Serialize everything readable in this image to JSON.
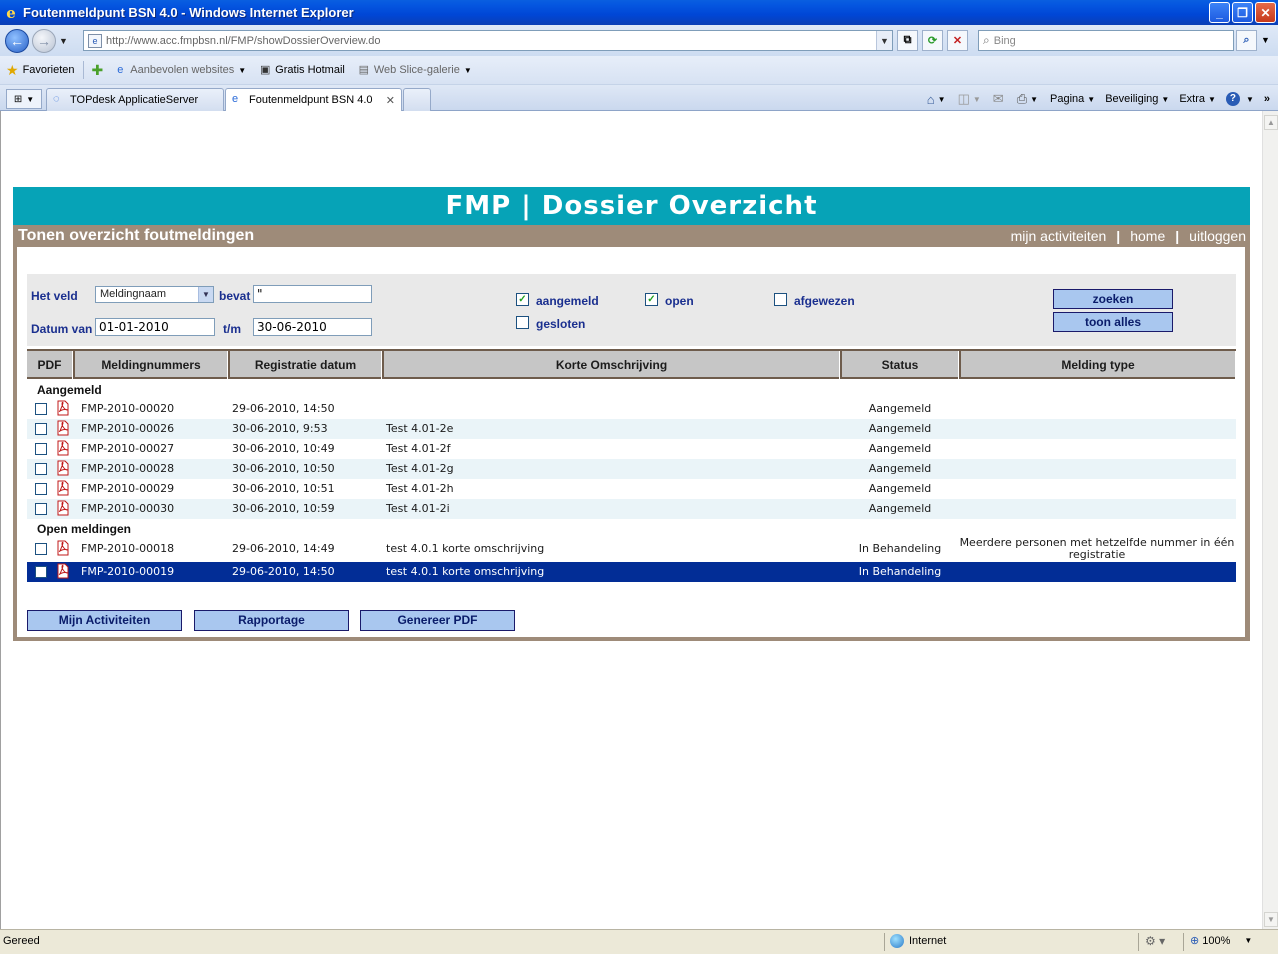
{
  "window": {
    "title": "Foutenmeldpunt BSN 4.0 - Windows Internet Explorer",
    "controls": [
      "minimize",
      "maximize",
      "close"
    ]
  },
  "address_bar": {
    "url": "http://www.acc.fmpbsn.nl/FMP/showDossierOverview.do",
    "search_placeholder": "Bing"
  },
  "favorites_bar": {
    "favorites_label": "Favorieten",
    "items": [
      {
        "label": "Aanbevolen websites",
        "icon": "ie-icon"
      },
      {
        "label": "Gratis Hotmail",
        "icon": "hotmail-icon"
      },
      {
        "label": "Web Slice-galerie",
        "icon": "webslice-icon"
      }
    ]
  },
  "tabs": [
    {
      "label": "TOPdesk ApplicatieServer",
      "active": false
    },
    {
      "label": "Foutenmeldpunt BSN 4.0",
      "active": true
    }
  ],
  "command_bar": {
    "pagina": "Pagina",
    "beveiliging": "Beveiliging",
    "extra": "Extra"
  },
  "app": {
    "header": "FMP | Dossier Overzicht",
    "subtitle": "Tonen overzicht foutmeldingen",
    "links": [
      "mijn activiteiten",
      "home",
      "uitloggen"
    ]
  },
  "filter": {
    "field_label": "Het veld",
    "field_value": "Meldingnaam",
    "contains_label": "bevat",
    "contains_value": "\"",
    "date_from_label": "Datum van",
    "date_from": "01-01-2010",
    "date_to_label": "t/m",
    "date_to": "30-06-2010",
    "checkboxes": {
      "aangemeld": {
        "label": "aangemeld",
        "checked": true
      },
      "open": {
        "label": "open",
        "checked": true
      },
      "afgewezen": {
        "label": "afgewezen",
        "checked": false
      },
      "gesloten": {
        "label": "gesloten",
        "checked": false
      }
    },
    "search_button": "zoeken",
    "show_all_button": "toon alles"
  },
  "table": {
    "columns": [
      "PDF",
      "Meldingnummers",
      "Registratie datum",
      "Korte Omschrijving",
      "Status",
      "Melding type"
    ],
    "groups": [
      {
        "name": "Aangemeld",
        "rows": [
          {
            "nummer": "FMP-2010-00020",
            "datum": "29-06-2010, 14:50",
            "omschrijving": "",
            "status": "Aangemeld",
            "type": ""
          },
          {
            "nummer": "FMP-2010-00026",
            "datum": "30-06-2010, 9:53",
            "omschrijving": "Test 4.01-2e",
            "status": "Aangemeld",
            "type": ""
          },
          {
            "nummer": "FMP-2010-00027",
            "datum": "30-06-2010, 10:49",
            "omschrijving": "Test 4.01-2f",
            "status": "Aangemeld",
            "type": ""
          },
          {
            "nummer": "FMP-2010-00028",
            "datum": "30-06-2010, 10:50",
            "omschrijving": "Test 4.01-2g",
            "status": "Aangemeld",
            "type": ""
          },
          {
            "nummer": "FMP-2010-00029",
            "datum": "30-06-2010, 10:51",
            "omschrijving": "Test 4.01-2h",
            "status": "Aangemeld",
            "type": ""
          },
          {
            "nummer": "FMP-2010-00030",
            "datum": "30-06-2010, 10:59",
            "omschrijving": "Test 4.01-2i",
            "status": "Aangemeld",
            "type": ""
          }
        ]
      },
      {
        "name": "Open meldingen",
        "rows": [
          {
            "nummer": "FMP-2010-00018",
            "datum": "29-06-2010, 14:49",
            "omschrijving": "test 4.0.1 korte omschrijving",
            "status": "In Behandeling",
            "type": "Meerdere personen met hetzelfde nummer in één registratie"
          },
          {
            "nummer": "FMP-2010-00019",
            "datum": "29-06-2010, 14:50",
            "omschrijving": "test 4.0.1 korte omschrijving",
            "status": "In Behandeling",
            "type": "",
            "selected": true
          }
        ]
      }
    ]
  },
  "actions": {
    "activiteiten": "Mijn Activiteiten",
    "rapportage": "Rapportage",
    "genereer_pdf": "Genereer PDF"
  },
  "status_bar": {
    "text": "Gereed",
    "zone": "Internet",
    "zoom": "100%"
  },
  "colors": {
    "header_teal": "#06a3b7",
    "frame_brown": "#9e8b79",
    "button_blue": "#a9c7ef",
    "selection": "#022d96"
  }
}
